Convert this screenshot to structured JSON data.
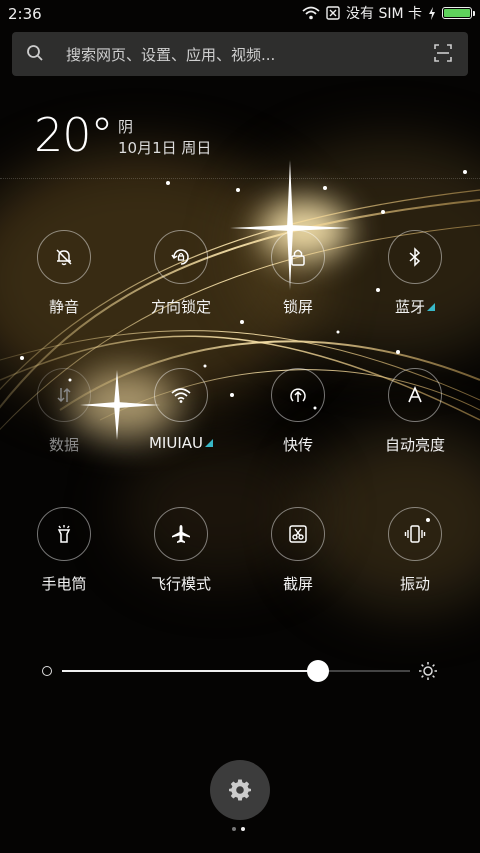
{
  "status_bar": {
    "time": "2:36",
    "carrier": "没有 SIM 卡",
    "battery_level": 1.0,
    "battery_color": "#5fd35c"
  },
  "search": {
    "placeholder": "搜索网页、设置、应用、视频...",
    "icons": [
      "search-icon",
      "scan-icon"
    ]
  },
  "weather": {
    "temperature": "20°",
    "condition": "阴",
    "date": "10月1日 周日"
  },
  "toggles": [
    {
      "label": "静音",
      "icon": "mute-icon",
      "active": true
    },
    {
      "label": "方向锁定",
      "icon": "rotation-lock-icon",
      "active": true
    },
    {
      "label": "锁屏",
      "icon": "lock-icon",
      "active": true
    },
    {
      "label": "蓝牙",
      "icon": "bluetooth-icon",
      "active": true,
      "expandable": true
    },
    {
      "label": "数据",
      "icon": "mobile-data-icon",
      "active": false
    },
    {
      "label": "MIUIAU",
      "icon": "wifi-icon",
      "active": true,
      "expandable": true
    },
    {
      "label": "快传",
      "icon": "share-icon",
      "active": true
    },
    {
      "label": "自动亮度",
      "icon": "auto-brightness-icon",
      "active": true
    },
    {
      "label": "手电筒",
      "icon": "flashlight-icon",
      "active": true
    },
    {
      "label": "飞行模式",
      "icon": "airplane-icon",
      "active": true
    },
    {
      "label": "截屏",
      "icon": "screenshot-icon",
      "active": true
    },
    {
      "label": "振动",
      "icon": "vibrate-icon",
      "active": true
    }
  ],
  "brightness": {
    "level": 0.735
  },
  "pager": {
    "pages": 2,
    "current": 2
  },
  "colors": {
    "accent_triangle": "#38b8c8",
    "wallpaper_gold": "#c9a55a"
  }
}
